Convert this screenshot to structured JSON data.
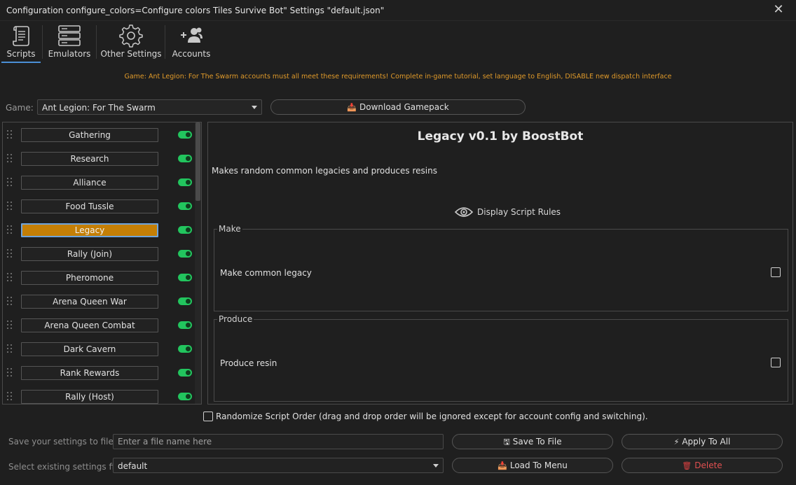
{
  "window": {
    "title": "Configuration configure_colors=Configure colors Tiles Survive Bot\" Settings \"default.json\"",
    "close_icon": "close-icon"
  },
  "toolbar": {
    "tabs": [
      {
        "label": "Scripts",
        "icon": "scroll-icon",
        "active": true
      },
      {
        "label": "Emulators",
        "icon": "server-icon",
        "active": false
      },
      {
        "label": "Other Settings",
        "icon": "gear-icon",
        "active": false
      },
      {
        "label": "Accounts",
        "icon": "user-add-icon",
        "active": false
      }
    ]
  },
  "warning": "Game: Ant Legion: For The Swarm accounts must all meet these requirements! Complete in-game tutorial, set language to English, DISABLE new dispatch interface",
  "game": {
    "label": "Game:",
    "selected": "Ant Legion: For The Swarm",
    "download_label": "Download Gamepack"
  },
  "scripts": [
    {
      "label": "Gathering",
      "enabled": true,
      "selected": false
    },
    {
      "label": "Research",
      "enabled": true,
      "selected": false
    },
    {
      "label": "Alliance",
      "enabled": true,
      "selected": false
    },
    {
      "label": "Food Tussle",
      "enabled": true,
      "selected": false
    },
    {
      "label": "Legacy",
      "enabled": true,
      "selected": true
    },
    {
      "label": "Rally (Join)",
      "enabled": true,
      "selected": false
    },
    {
      "label": "Pheromone",
      "enabled": true,
      "selected": false
    },
    {
      "label": "Arena Queen War",
      "enabled": true,
      "selected": false
    },
    {
      "label": "Arena Queen Combat",
      "enabled": true,
      "selected": false
    },
    {
      "label": "Dark Cavern",
      "enabled": true,
      "selected": false
    },
    {
      "label": "Rank Rewards",
      "enabled": true,
      "selected": false
    },
    {
      "label": "Rally (Host)",
      "enabled": true,
      "selected": false
    }
  ],
  "detail": {
    "title": "Legacy v0.1 by BoostBot",
    "description": "Makes random common legacies and produces resins",
    "rules_label": "Display Script Rules",
    "groups": [
      {
        "title": "Make",
        "options": [
          {
            "label": "Make common legacy",
            "checked": false
          }
        ]
      },
      {
        "title": "Produce",
        "options": [
          {
            "label": "Produce resin",
            "checked": false
          }
        ]
      }
    ]
  },
  "randomize": {
    "label": "Randomize Script Order (drag and drop order will be ignored except for account config and switching).",
    "checked": false
  },
  "bottom": {
    "save_label": "Save your settings to file",
    "save_placeholder": "Enter a file name here",
    "save_button": "Save To File",
    "apply_button": "Apply To All",
    "select_label": "Select existing settings file",
    "selected_file": "default",
    "load_button": "Load To Menu",
    "delete_button": "Delete"
  },
  "colors": {
    "background": "#1f1f1f",
    "accent_selected": "#c47f06",
    "toggle_on": "#22c55e",
    "warning": "#e09a2a",
    "delete": "#e05050"
  }
}
